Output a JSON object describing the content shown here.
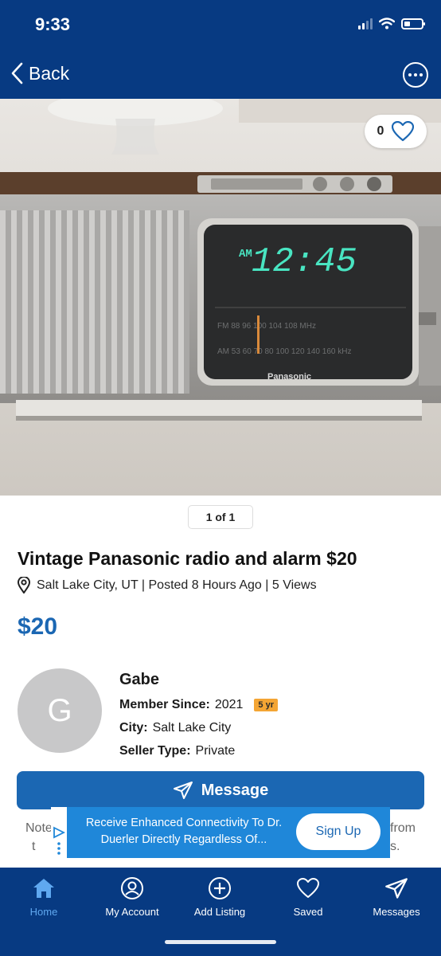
{
  "status_bar": {
    "time": "9:33"
  },
  "header": {
    "back_label": "Back"
  },
  "photo": {
    "favorite_count": "0",
    "clock_display_period": "AM",
    "clock_display_time": "12:45",
    "brand_text": "Panasonic",
    "dial_fm_row": "FM 88 96 100 104 108 MHz",
    "dial_am_row": "AM 53 60 70 80 100 120 140 160 kHz"
  },
  "pager": {
    "label": "1 of 1"
  },
  "listing": {
    "title": "Vintage Panasonic radio and alarm $20",
    "meta": "Salt Lake City, UT | Posted 8 Hours Ago | 5 Views",
    "price": "$20"
  },
  "seller": {
    "initial": "G",
    "name": "Gabe",
    "member_since_label": "Member Since:",
    "member_since_value": "2021",
    "member_badge": "5 yr",
    "city_label": "City:",
    "city_value": "Salt Lake City",
    "type_label": "Seller Type:",
    "type_value": "Private"
  },
  "message_button": {
    "label": "Message"
  },
  "notice": {
    "left_line1": "Note",
    "left_line2": "t",
    "right_line1": "from",
    "right_line2": "s."
  },
  "ad": {
    "text": "Receive Enhanced Connectivity To Dr. Duerler Directly Regardless Of...",
    "button_label": "Sign Up"
  },
  "tabbar": {
    "items": [
      {
        "label": "Home",
        "icon": "home-icon"
      },
      {
        "label": "My Account",
        "icon": "account-icon"
      },
      {
        "label": "Add Listing",
        "icon": "add-listing-icon"
      },
      {
        "label": "Saved",
        "icon": "heart-icon"
      },
      {
        "label": "Messages",
        "icon": "send-icon"
      }
    ]
  },
  "colors": {
    "navy": "#073a82",
    "accent_blue": "#1b67b3",
    "active_tab": "#5fa8f0",
    "badge_orange": "#f4a534",
    "clock_green": "#49e5c2"
  }
}
